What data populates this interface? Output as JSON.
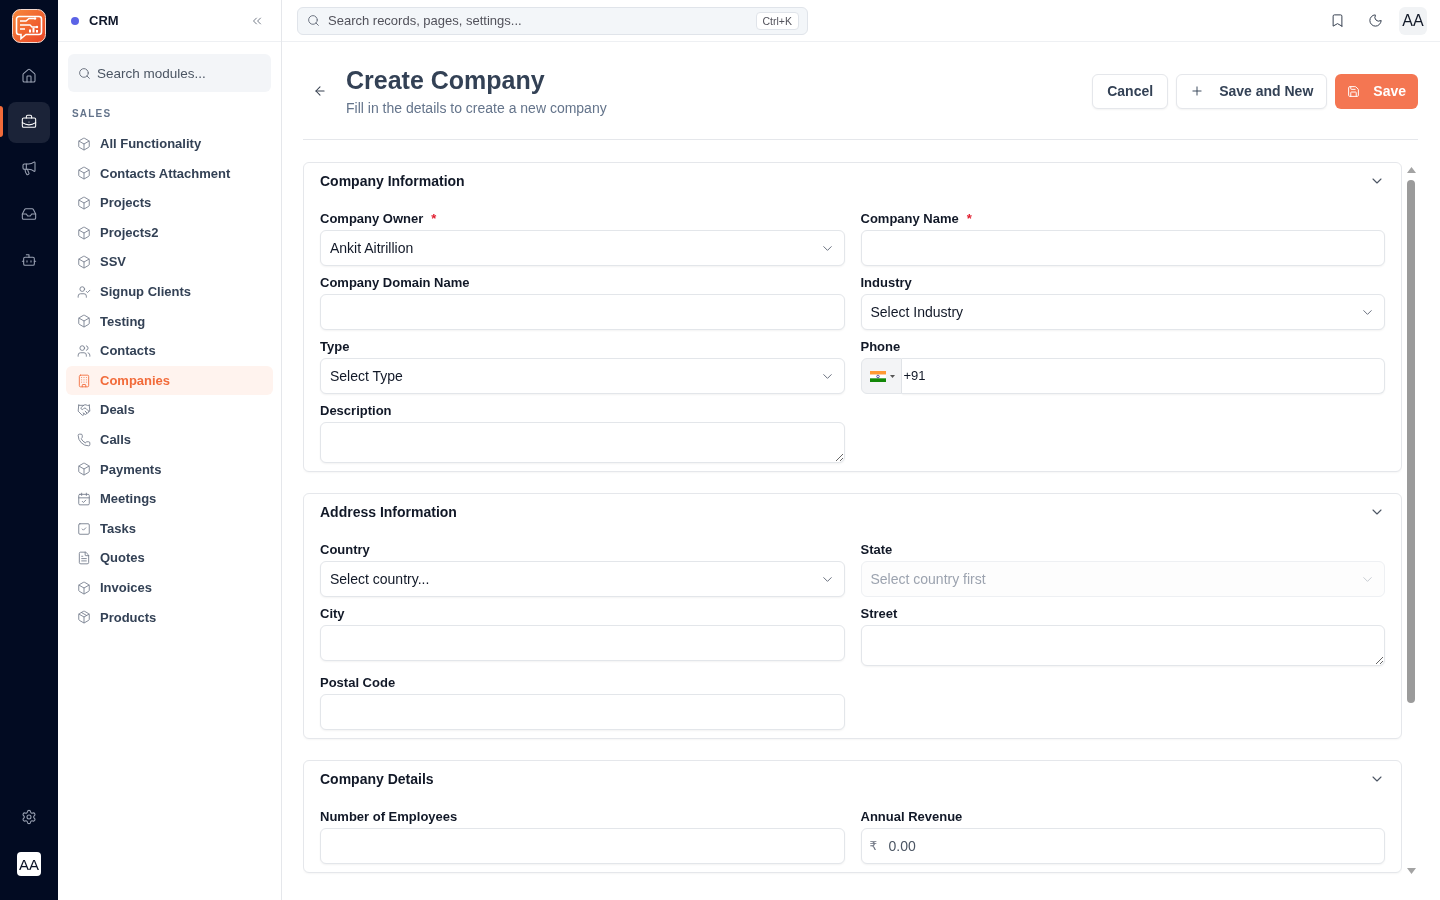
{
  "rail": {
    "items": [
      {
        "selected": false
      },
      {
        "selected": true
      },
      {
        "selected": false
      },
      {
        "selected": false
      },
      {
        "selected": false
      }
    ],
    "avatar": "AA"
  },
  "sidebar": {
    "title": "CRM",
    "search": {
      "placeholder": "Search modules..."
    },
    "section": "SALES",
    "items": [
      {
        "label": "All Functionality",
        "selected": false
      },
      {
        "label": "Contacts Attachment",
        "selected": false
      },
      {
        "label": "Projects",
        "selected": false
      },
      {
        "label": "Projects2",
        "selected": false
      },
      {
        "label": "SSV",
        "selected": false
      },
      {
        "label": "Signup Clients",
        "selected": false
      },
      {
        "label": "Testing",
        "selected": false
      },
      {
        "label": "Contacts",
        "selected": false
      },
      {
        "label": "Companies",
        "selected": true
      },
      {
        "label": "Deals",
        "selected": false
      },
      {
        "label": "Calls",
        "selected": false
      },
      {
        "label": "Payments",
        "selected": false
      },
      {
        "label": "Meetings",
        "selected": false
      },
      {
        "label": "Tasks",
        "selected": false
      },
      {
        "label": "Quotes",
        "selected": false
      },
      {
        "label": "Invoices",
        "selected": false
      },
      {
        "label": "Products",
        "selected": false
      }
    ]
  },
  "topbar": {
    "search": {
      "placeholder": "Search records, pages, settings...",
      "shortcut": "Ctrl+K"
    },
    "avatar": "AA"
  },
  "header": {
    "title": "Create Company",
    "subtitle": "Fill in the details to create a new company",
    "buttons": [
      {
        "label": "Cancel",
        "kind": "plain"
      },
      {
        "label": "Save and New",
        "kind": "add"
      },
      {
        "label": "Save",
        "kind": "primary"
      }
    ]
  },
  "sections": [
    {
      "title": "Company Information",
      "expanded": true,
      "fields": [
        {
          "label": "Company Owner",
          "required_mark": "*",
          "kind": "select",
          "value": "Ankit Aitrillion",
          "disabled": false
        },
        {
          "label": "Company Name",
          "required_mark": "*",
          "kind": "text",
          "disabled": false
        },
        {
          "label": "Company Domain Name",
          "kind": "text",
          "disabled": false
        },
        {
          "label": "Industry",
          "kind": "select",
          "value": "Select Industry",
          "disabled": false
        },
        {
          "label": "Type",
          "kind": "select",
          "value": "Select Type",
          "disabled": false
        },
        {
          "label": "Phone",
          "kind": "phone",
          "value": "+91",
          "disabled": false
        },
        {
          "label": "Description",
          "kind": "textarea",
          "disabled": false
        }
      ]
    },
    {
      "title": "Address Information",
      "expanded": true,
      "fields": [
        {
          "label": "Country",
          "kind": "select",
          "value": "Select country...",
          "disabled": false
        },
        {
          "label": "State",
          "kind": "select",
          "placeholder": "Select country first",
          "disabled": true
        },
        {
          "label": "City",
          "kind": "text",
          "disabled": false
        },
        {
          "label": "Street",
          "kind": "textarea",
          "disabled": false
        },
        {
          "label": "Postal Code",
          "kind": "text",
          "disabled": false
        }
      ]
    },
    {
      "title": "Company Details",
      "expanded": true,
      "fields": [
        {
          "label": "Number of Employees",
          "kind": "text",
          "disabled": false
        },
        {
          "label": "Annual Revenue",
          "kind": "currency",
          "prefix": "₹",
          "placeholder": "0.00",
          "disabled": false
        }
      ]
    }
  ]
}
